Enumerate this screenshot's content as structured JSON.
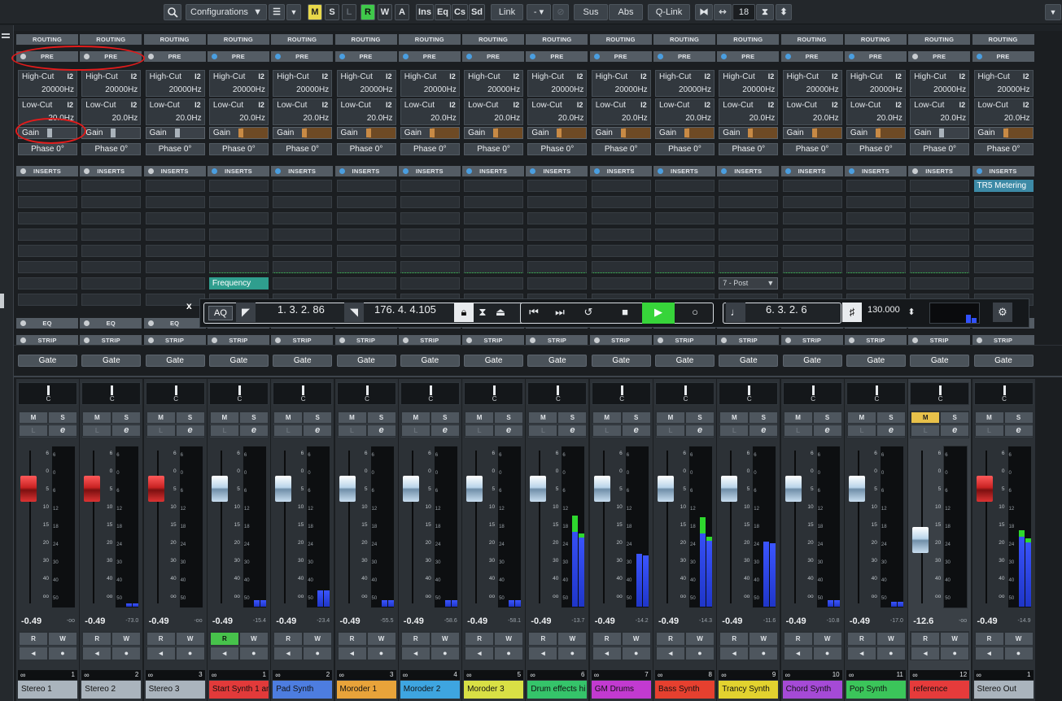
{
  "toolbar": {
    "configurations": "Configurations",
    "mode_m": "M",
    "mode_s": "S",
    "mode_l": "L",
    "mode_r": "R",
    "mode_w": "W",
    "mode_a": "A",
    "ins": "Ins",
    "eq": "Eq",
    "cs": "Cs",
    "sd": "Sd",
    "link": "Link",
    "link_menu": "-",
    "sus": "Sus",
    "abs": "Abs",
    "qlink": "Q-Link",
    "width_value": "18"
  },
  "labels": {
    "routing": "ROUTING",
    "pre": "PRE",
    "inserts": "INSERTS",
    "eq": "EQ",
    "strip": "STRIP",
    "highcut": "High-Cut",
    "lowcut": "Low-Cut",
    "highcut_val": "20000Hz",
    "lowcut_val": "20.0Hz",
    "gain": "Gain",
    "phase": "Phase 0°",
    "gate": "Gate",
    "filter_icon": "I2",
    "pan_c": "C",
    "m": "M",
    "s": "S",
    "l": "L",
    "e": "e",
    "r": "R",
    "w": "W",
    "link_icon": "∞"
  },
  "transport": {
    "aq": "AQ",
    "left_locator": "1. 3. 2. 86",
    "right_locator": "176. 4. 4.105",
    "position": "6. 3. 2.  6",
    "tempo": "130.000",
    "close": "x"
  },
  "channels": [
    {
      "name": "Stereo 1",
      "num": "1",
      "color": "#aab4bd",
      "vol": "-0.49",
      "peak": "-oo",
      "fader": "red",
      "meter": [
        0,
        0
      ],
      "peaklevel": 0,
      "pre_blue": false,
      "gain_orange": false,
      "ins_blue": false
    },
    {
      "name": "Stereo 2",
      "num": "2",
      "color": "#aab4bd",
      "vol": "-0.49",
      "peak": "-73.0",
      "fader": "red",
      "meter": [
        0.02,
        0.02
      ],
      "peaklevel": 0,
      "pre_blue": false,
      "gain_orange": false,
      "ins_blue": false
    },
    {
      "name": "Stereo 3",
      "num": "3",
      "color": "#aab4bd",
      "vol": "-0.49",
      "peak": "-oo",
      "fader": "red",
      "meter": [
        0,
        0
      ],
      "peaklevel": 0,
      "pre_blue": false,
      "gain_orange": false,
      "ins_blue": false
    },
    {
      "name": "Start Synth 1 an",
      "num": "1",
      "color": "#e23a3a",
      "vol": "-0.49",
      "peak": "-15.4",
      "fader": "white",
      "meter": [
        0.04,
        0.04
      ],
      "peaklevel": 0,
      "pre_blue": true,
      "gain_orange": true,
      "ins_blue": true,
      "r_on": true,
      "fx": "Frequency"
    },
    {
      "name": "Pad Synth",
      "num": "2",
      "color": "#4d7de0",
      "vol": "-0.49",
      "peak": "-23.4",
      "fader": "white",
      "meter": [
        0.1,
        0.1
      ],
      "peaklevel": 0,
      "pre_blue": true,
      "gain_orange": true,
      "ins_blue": true
    },
    {
      "name": "Moroder 1",
      "num": "3",
      "color": "#e8a33a",
      "vol": "-0.49",
      "peak": "-55.5",
      "fader": "white",
      "meter": [
        0.04,
        0.04
      ],
      "peaklevel": 0,
      "pre_blue": true,
      "gain_orange": true,
      "ins_blue": true
    },
    {
      "name": "Moroder 2",
      "num": "4",
      "color": "#3ea5e0",
      "vol": "-0.49",
      "peak": "-58.6",
      "fader": "white",
      "meter": [
        0.04,
        0.04
      ],
      "peaklevel": 0,
      "pre_blue": true,
      "gain_orange": true,
      "ins_blue": true
    },
    {
      "name": "Moroder 3",
      "num": "5",
      "color": "#d9e045",
      "vol": "-0.49",
      "peak": "-58.1",
      "fader": "white",
      "meter": [
        0.04,
        0.04
      ],
      "peaklevel": 0,
      "pre_blue": true,
      "gain_orange": true,
      "ins_blue": true
    },
    {
      "name": "Drum effects hi",
      "num": "6",
      "color": "#35c46a",
      "vol": "-0.49",
      "peak": "-13.7",
      "fader": "white",
      "meter": [
        0.57,
        0.46
      ],
      "peaklevel": 0.1,
      "pre_blue": true,
      "gain_orange": true,
      "ins_blue": true
    },
    {
      "name": "GM Drums",
      "num": "7",
      "color": "#c23ad0",
      "vol": "-0.49",
      "peak": "-14.2",
      "fader": "white",
      "meter": [
        0.33,
        0.32
      ],
      "peaklevel": 0,
      "pre_blue": true,
      "gain_orange": true,
      "ins_blue": true
    },
    {
      "name": "Bass Synth",
      "num": "8",
      "color": "#e6402f",
      "vol": "-0.49",
      "peak": "-14.3",
      "fader": "white",
      "meter": [
        0.56,
        0.44
      ],
      "peaklevel": 0.1,
      "pre_blue": true,
      "gain_orange": true,
      "ins_blue": true
    },
    {
      "name": "Trancy Synth",
      "num": "9",
      "color": "#e2d22f",
      "vol": "-0.49",
      "peak": "-11.6",
      "fader": "white",
      "meter": [
        0.41,
        0.4
      ],
      "peaklevel": 0,
      "pre_blue": true,
      "gain_orange": true,
      "ins_blue": true,
      "dd": "7 - Post"
    },
    {
      "name": "Chord Synth",
      "num": "10",
      "color": "#a54ad6",
      "vol": "-0.49",
      "peak": "-10.8",
      "fader": "white",
      "meter": [
        0.04,
        0.04
      ],
      "peaklevel": 0,
      "pre_blue": true,
      "gain_orange": true,
      "ins_blue": true
    },
    {
      "name": "Pop Synth",
      "num": "11",
      "color": "#3bc55a",
      "vol": "-0.49",
      "peak": "-17.0",
      "fader": "white",
      "meter": [
        0.03,
        0.03
      ],
      "peaklevel": 0,
      "pre_blue": true,
      "gain_orange": true,
      "ins_blue": true
    },
    {
      "name": "reference",
      "num": "12",
      "color": "#e53b3b",
      "vol": "-12.6",
      "peak": "-oo",
      "fader": "white",
      "meter": [
        0,
        0
      ],
      "peaklevel": 0,
      "pre_blue": false,
      "gain_orange": false,
      "ins_blue": false,
      "m_on": true,
      "low": true
    },
    {
      "name": "Stereo Out",
      "num": "1",
      "color": "#aab4bd",
      "vol": "-0.49",
      "peak": "-14.9",
      "fader": "red",
      "meter": [
        0.48,
        0.43
      ],
      "peaklevel": 0.04,
      "pre_blue": true,
      "gain_orange": true,
      "ins_blue": true,
      "fx_top": "TR5 Metering"
    }
  ],
  "meter_scale": [
    "6",
    "0",
    "6",
    "12",
    "18",
    "24",
    "30",
    "40",
    "50"
  ],
  "fader_scale": [
    "6",
    "0",
    "5",
    "10",
    "15",
    "20",
    "30",
    "40",
    "oo"
  ]
}
